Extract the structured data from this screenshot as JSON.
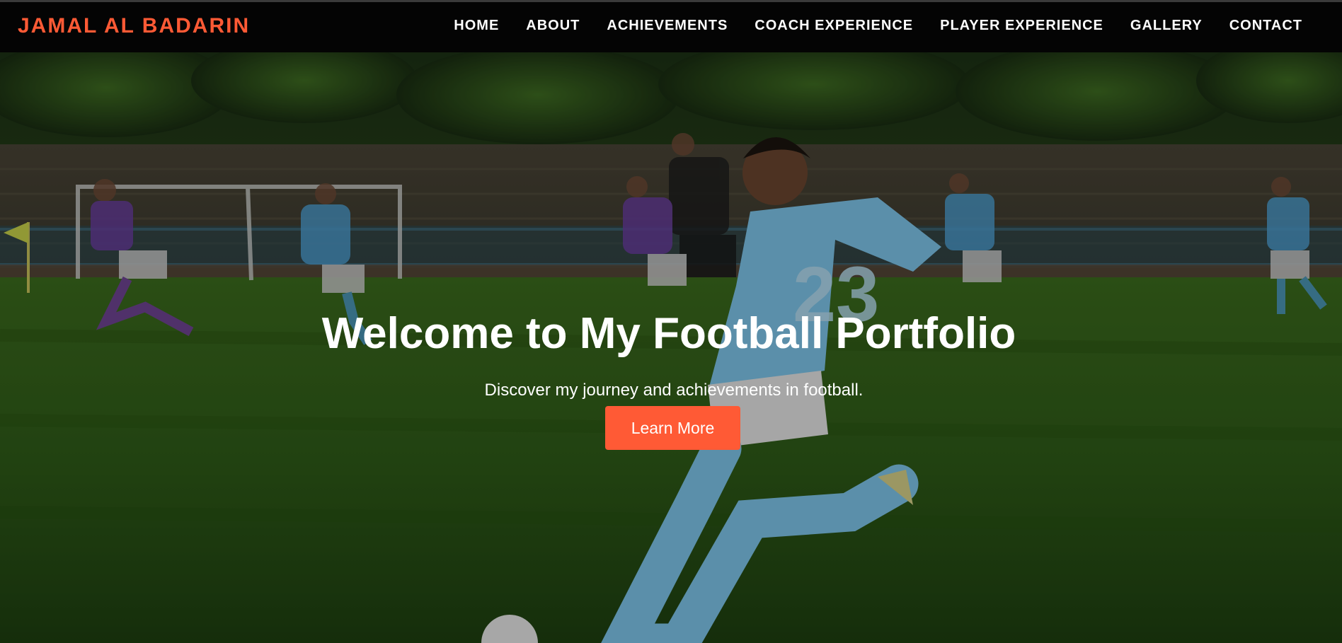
{
  "brand": {
    "name": "JAMAL AL BADARIN",
    "color": "#ff5a35"
  },
  "nav": {
    "items": [
      {
        "label": "HOME"
      },
      {
        "label": "ABOUT"
      },
      {
        "label": "ACHIEVEMENTS"
      },
      {
        "label": "COACH EXPERIENCE"
      },
      {
        "label": "PLAYER EXPERIENCE"
      },
      {
        "label": "GALLERY"
      },
      {
        "label": "CONTACT"
      }
    ]
  },
  "hero": {
    "image": "football-player-kicking-ball-photo",
    "title": "Welcome to My Football Portfolio",
    "subtitle": "Discover my journey and achievements in football.",
    "cta_label": "Learn More",
    "cta_color": "#ff5a35"
  }
}
